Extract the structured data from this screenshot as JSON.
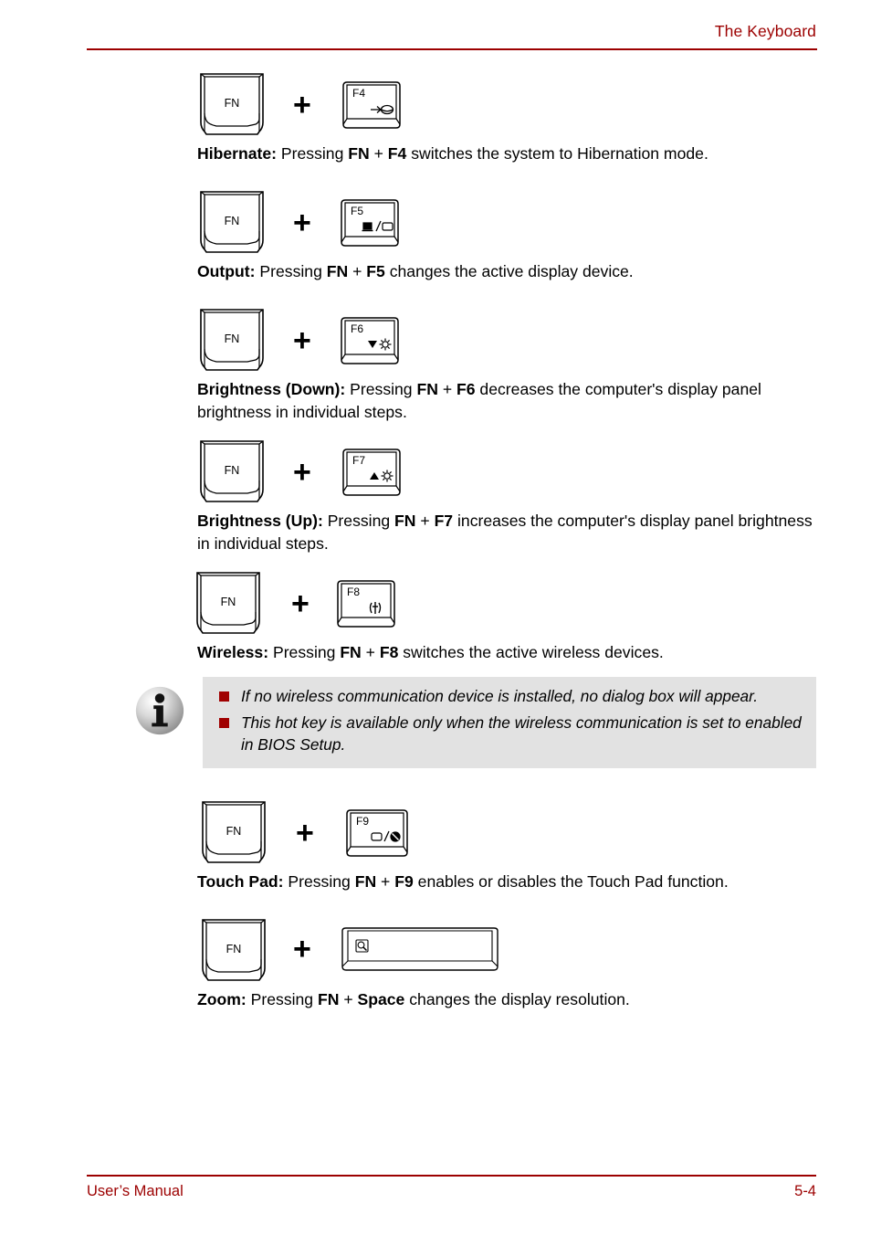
{
  "header": {
    "title": "The Keyboard"
  },
  "footer": {
    "left": "User’s Manual",
    "right": "5-4"
  },
  "keys": {
    "fn_label": "FN",
    "plus": "+"
  },
  "hotkeys": [
    {
      "key_label": "F4",
      "icon_name": "hibernate-icon",
      "desc_bold": "Hibernate:",
      "desc_parts": [
        {
          "text": " Pressing ",
          "bold": false
        },
        {
          "text": "FN",
          "bold": true
        },
        {
          "text": " + ",
          "bold": false
        },
        {
          "text": "F4",
          "bold": true
        },
        {
          "text": " switches the system to Hibernation mode.",
          "bold": false
        }
      ]
    },
    {
      "key_label": "F5",
      "icon_name": "display-output-icon",
      "desc_bold": "Output:",
      "desc_parts": [
        {
          "text": " Pressing ",
          "bold": false
        },
        {
          "text": "FN",
          "bold": true
        },
        {
          "text": " + ",
          "bold": false
        },
        {
          "text": "F5",
          "bold": true
        },
        {
          "text": " changes the active display device.",
          "bold": false
        }
      ]
    },
    {
      "key_label": "F6",
      "icon_name": "brightness-down-icon",
      "desc_bold": "Brightness (Down):",
      "desc_parts": [
        {
          "text": " Pressing ",
          "bold": false
        },
        {
          "text": "FN",
          "bold": true
        },
        {
          "text": " + ",
          "bold": false
        },
        {
          "text": "F6",
          "bold": true
        },
        {
          "text": " decreases the computer's display panel brightness in individual steps.",
          "bold": false
        }
      ]
    },
    {
      "key_label": "F7",
      "icon_name": "brightness-up-icon",
      "desc_bold": "Brightness (Up):",
      "desc_parts": [
        {
          "text": " Pressing ",
          "bold": false
        },
        {
          "text": "FN",
          "bold": true
        },
        {
          "text": " + ",
          "bold": false
        },
        {
          "text": "F7",
          "bold": true
        },
        {
          "text": " increases the computer's display panel brightness in individual steps.",
          "bold": false
        }
      ]
    },
    {
      "key_label": "F8",
      "icon_name": "wireless-antenna-icon",
      "desc_bold": "Wireless:",
      "desc_parts": [
        {
          "text": " Pressing ",
          "bold": false
        },
        {
          "text": "FN",
          "bold": true
        },
        {
          "text": " + ",
          "bold": false
        },
        {
          "text": "F8",
          "bold": true
        },
        {
          "text": " switches the active wireless devices.",
          "bold": false
        }
      ]
    },
    {
      "key_label": "F9",
      "icon_name": "touchpad-toggle-icon",
      "desc_bold": "Touch Pad:",
      "desc_parts": [
        {
          "text": " Pressing ",
          "bold": false
        },
        {
          "text": "FN",
          "bold": true
        },
        {
          "text": " + ",
          "bold": false
        },
        {
          "text": "F9",
          "bold": true
        },
        {
          "text": " enables or disables the Touch Pad function.",
          "bold": false
        }
      ]
    },
    {
      "key_label": "",
      "icon_name": "zoom-magnifier-icon",
      "desc_bold": "Zoom:",
      "desc_parts": [
        {
          "text": " Pressing ",
          "bold": false
        },
        {
          "text": "FN",
          "bold": true
        },
        {
          "text": " + ",
          "bold": false
        },
        {
          "text": "Space",
          "bold": true
        },
        {
          "text": " changes the display resolution.",
          "bold": false
        }
      ]
    }
  ],
  "note": {
    "icon_name": "info-icon",
    "items": [
      "If no wireless communication device is installed, no dialog box will appear.",
      "This hot key is available only when the wireless communication is set to enabled in BIOS Setup."
    ]
  },
  "colors": {
    "accent_red": "#9c0000",
    "bullet_red": "#a00000",
    "note_bg": "#e2e2e2"
  }
}
